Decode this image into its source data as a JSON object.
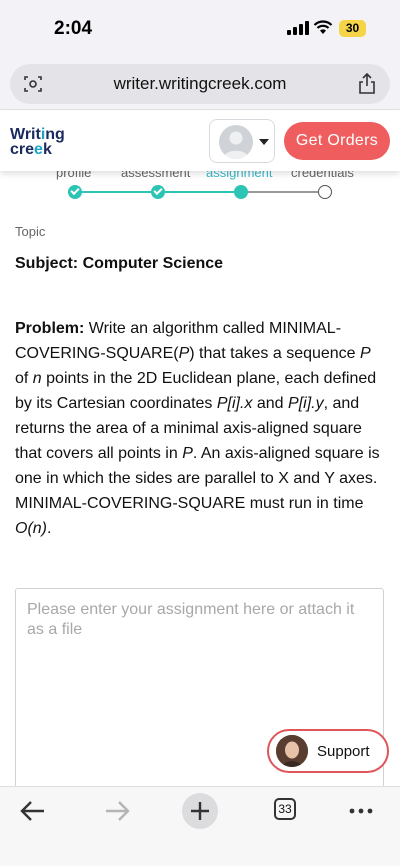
{
  "status_bar": {
    "time": "2:04",
    "battery": "30"
  },
  "browser": {
    "url": "writer.writingcreek.com",
    "tab_count": "33"
  },
  "header": {
    "logo_line1": "Writ",
    "logo_line1_b": "ng",
    "logo_line2": "cre",
    "logo_line2_b": "k",
    "get_orders_label": "Get Orders"
  },
  "stepper": {
    "steps": [
      {
        "label": "profile",
        "status": "done"
      },
      {
        "label": "assessment",
        "status": "done"
      },
      {
        "label": "assignment",
        "status": "current"
      },
      {
        "label": "credentials",
        "status": "pending"
      }
    ]
  },
  "content": {
    "topic_label": "Topic",
    "subject": "Subject: Computer Science",
    "problem": {
      "lead": "Problem:",
      "t1": " Write an algorithm called MINIMAL-COVERING-SQUARE(",
      "v1": "P",
      "t2": ") that takes a sequence ",
      "v2": "P",
      "t3": " of ",
      "v3": "n",
      "t4": " points in the 2D Euclidean plane, each defined by its Cartesian coordinates ",
      "v4": "P[i].x",
      "t5": " and ",
      "v5": "P[i].y",
      "t6": ", and returns the area of a minimal axis-aligned square that covers all points in ",
      "v6": "P",
      "t7": ". An axis-aligned square is one in which the sides are parallel to X and Y axes. MINIMAL-COVERING-SQUARE must run in time ",
      "v7": "O(n)",
      "t8": "."
    },
    "textarea_placeholder": "Please enter your assignment here or attach it as a file"
  },
  "support": {
    "label": "Support"
  },
  "colors": {
    "accent": "#2cc4b4",
    "brand_red": "#f05d5e",
    "logo_navy": "#1a2a5e"
  },
  "icons": {
    "reader": "reader-mode-icon",
    "share": "share-icon",
    "back": "back-arrow-icon",
    "forward": "forward-arrow-icon",
    "new_tab": "plus-icon",
    "more": "more-dots-icon"
  }
}
